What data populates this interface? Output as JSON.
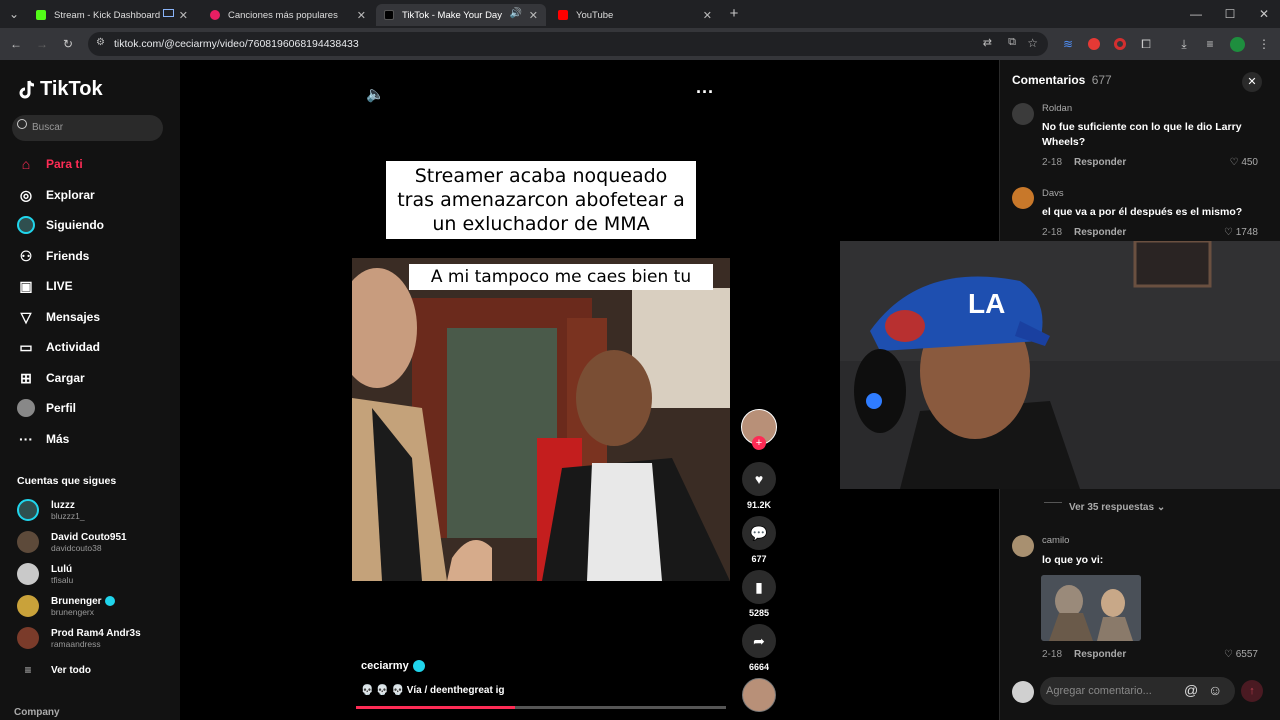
{
  "browser": {
    "tabs": [
      {
        "title": "Stream - Kick Dashboard",
        "color": "#53fc18"
      },
      {
        "title": "Canciones más populares",
        "color": "#e91e63"
      },
      {
        "title": "TikTok - Make Your Day",
        "color": "#ffffff"
      },
      {
        "title": "YouTube",
        "color": "#ff0000"
      }
    ],
    "url": "tiktok.com/@ceciarmy/video/7608196068194438433"
  },
  "sidebar": {
    "logo": "TikTok",
    "search_placeholder": "Buscar",
    "nav": [
      {
        "label": "Para ti",
        "icon": "home-icon"
      },
      {
        "label": "Explorar",
        "icon": "compass-icon"
      },
      {
        "label": "Siguiendo",
        "icon": "following-icon"
      },
      {
        "label": "Friends",
        "icon": "friends-icon"
      },
      {
        "label": "LIVE",
        "icon": "live-icon"
      },
      {
        "label": "Mensajes",
        "icon": "send-icon"
      },
      {
        "label": "Actividad",
        "icon": "activity-icon"
      },
      {
        "label": "Cargar",
        "icon": "upload-icon"
      },
      {
        "label": "Perfil",
        "icon": "profile-icon"
      },
      {
        "label": "Más",
        "icon": "more-icon"
      }
    ],
    "following_title": "Cuentas que sigues",
    "accounts": [
      {
        "name": "luzzz",
        "handle": "bluzzz1_"
      },
      {
        "name": "David Couto951",
        "handle": "davidcouto38"
      },
      {
        "name": "Lulú",
        "handle": "tfisalu"
      },
      {
        "name": "Brunenger",
        "handle": "brunengerx"
      },
      {
        "name": "Prod Ram4 Andr3s",
        "handle": "ramaandress"
      }
    ],
    "see_all": "Ver todo",
    "company": "Company"
  },
  "video": {
    "title_caption": "Streamer acaba noqueado tras amenazarcon abofetear a un exluchador de MMA",
    "inner_caption": "A mi tampoco me caes bien tu",
    "author": "ceciarmy",
    "description": "💀 💀 💀 Vía / deenthegreat ig",
    "progress": 0.43,
    "likes": "91.2K",
    "comments": "677",
    "saves": "5285",
    "shares": "6664"
  },
  "comments_panel": {
    "title": "Comentarios",
    "count": "677",
    "items": [
      {
        "user": "Roldan",
        "text": "No fue suficiente con lo que le dio Larry Wheels?",
        "date": "2-18",
        "reply": "Responder",
        "likes": "450"
      },
      {
        "user": "Davs",
        "text": "el que va a por él después es el mismo?",
        "date": "2-18",
        "reply": "Responder",
        "likes": "1748"
      },
      {
        "user": "camilo",
        "text": "lo que yo vi:",
        "date": "2-18",
        "reply": "Responder",
        "likes": "6557"
      }
    ],
    "view_replies": "Ver 35 respuestas",
    "input_placeholder": "Agregar comentario..."
  }
}
